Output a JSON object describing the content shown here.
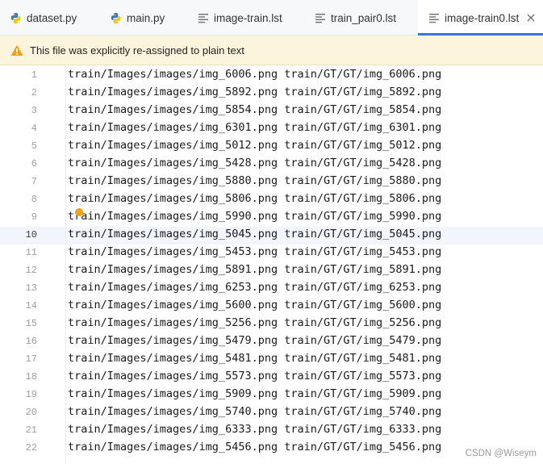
{
  "tabs": [
    {
      "label": "dataset.py",
      "icon": "python-icon",
      "active": false
    },
    {
      "label": "main.py",
      "icon": "python-icon",
      "active": false
    },
    {
      "label": "image-train.lst",
      "icon": "text-file-icon",
      "active": false
    },
    {
      "label": "train_pair0.lst",
      "icon": "text-file-icon",
      "active": false
    },
    {
      "label": "image-train0.lst",
      "icon": "text-file-icon",
      "active": true
    }
  ],
  "banner": {
    "icon": "warning-icon",
    "message": "This file was explicitly re-assigned to plain text"
  },
  "editor": {
    "current_line": 10,
    "lines": [
      {
        "num": "1",
        "text": "train/Images/images/img_6006.png train/GT/GT/img_6006.png"
      },
      {
        "num": "2",
        "text": "train/Images/images/img_5892.png train/GT/GT/img_5892.png"
      },
      {
        "num": "3",
        "text": "train/Images/images/img_5854.png train/GT/GT/img_5854.png"
      },
      {
        "num": "4",
        "text": "train/Images/images/img_6301.png train/GT/GT/img_6301.png"
      },
      {
        "num": "5",
        "text": "train/Images/images/img_5012.png train/GT/GT/img_5012.png"
      },
      {
        "num": "6",
        "text": "train/Images/images/img_5428.png train/GT/GT/img_5428.png"
      },
      {
        "num": "7",
        "text": "train/Images/images/img_5880.png train/GT/GT/img_5880.png"
      },
      {
        "num": "8",
        "text": "train/Images/images/img_5806.png train/GT/GT/img_5806.png"
      },
      {
        "num": "9",
        "text": "train/Images/images/img_5990.png train/GT/GT/img_5990.png"
      },
      {
        "num": "10",
        "text": "train/Images/images/img_5045.png train/GT/GT/img_5045.png"
      },
      {
        "num": "11",
        "text": "train/Images/images/img_5453.png train/GT/GT/img_5453.png"
      },
      {
        "num": "12",
        "text": "train/Images/images/img_5891.png train/GT/GT/img_5891.png"
      },
      {
        "num": "13",
        "text": "train/Images/images/img_6253.png train/GT/GT/img_6253.png"
      },
      {
        "num": "14",
        "text": "train/Images/images/img_5600.png train/GT/GT/img_5600.png"
      },
      {
        "num": "15",
        "text": "train/Images/images/img_5256.png train/GT/GT/img_5256.png"
      },
      {
        "num": "16",
        "text": "train/Images/images/img_5479.png train/GT/GT/img_5479.png"
      },
      {
        "num": "17",
        "text": "train/Images/images/img_5481.png train/GT/GT/img_5481.png"
      },
      {
        "num": "18",
        "text": "train/Images/images/img_5573.png train/GT/GT/img_5573.png"
      },
      {
        "num": "19",
        "text": "train/Images/images/img_5909.png train/GT/GT/img_5909.png"
      },
      {
        "num": "20",
        "text": "train/Images/images/img_5740.png train/GT/GT/img_5740.png"
      },
      {
        "num": "21",
        "text": "train/Images/images/img_6333.png train/GT/GT/img_6333.png"
      },
      {
        "num": "22",
        "text": "train/Images/images/img_5456.png train/GT/GT/img_5456.png"
      }
    ]
  },
  "watermark": "CSDN @Wiseym",
  "colors": {
    "accent": "#3574f0",
    "banner_bg": "#fdf4dd",
    "warning": "#e8a317",
    "bulb": "#f0a30a"
  }
}
